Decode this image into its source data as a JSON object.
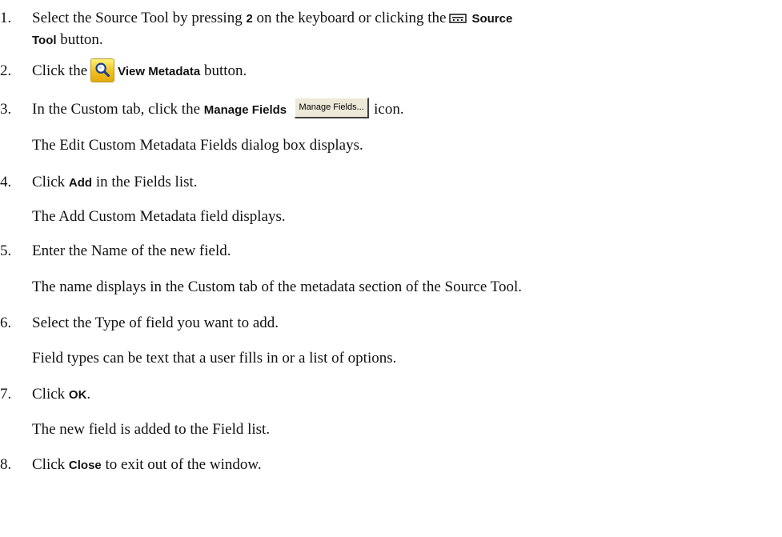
{
  "steps": [
    {
      "number": "1.",
      "line1_pre": "Select the Source Tool by pressing ",
      "key": "2",
      "line1_mid": " on the keyboard or clicking the",
      "button_part1": "Source",
      "button_part2": "Tool",
      "line2_post": " button.",
      "icon": "source-tool-icon"
    },
    {
      "number": "2.",
      "pre": "Click the",
      "button": "View Metadata",
      "post": " button.",
      "icon": "view-metadata-magnifier-icon"
    },
    {
      "number": "3.",
      "pre": "In the Custom tab, click the ",
      "button": "Manage Fields",
      "button_image_label": "Manage Fields...",
      "post": "icon.",
      "note": "The Edit Custom Metadata Fields dialog box displays."
    },
    {
      "number": "4.",
      "pre": "Click ",
      "button": "Add",
      "post": " in the Fields list.",
      "note": "The Add Custom Metadata field displays."
    },
    {
      "number": "5.",
      "text": "Enter the Name of the new field.",
      "note": "The name displays in the Custom tab of the metadata section of the Source Tool."
    },
    {
      "number": "6.",
      "text": "Select the Type of field you want to add.",
      "note": "Field types can be text that a user fills in or a list of options."
    },
    {
      "number": "7.",
      "pre": "Click ",
      "button": "OK",
      "post": ".",
      "note": "The new field is added to the Field list."
    },
    {
      "number": "8.",
      "pre": "Click ",
      "button": "Close",
      "post": " to exit out of the window."
    }
  ]
}
